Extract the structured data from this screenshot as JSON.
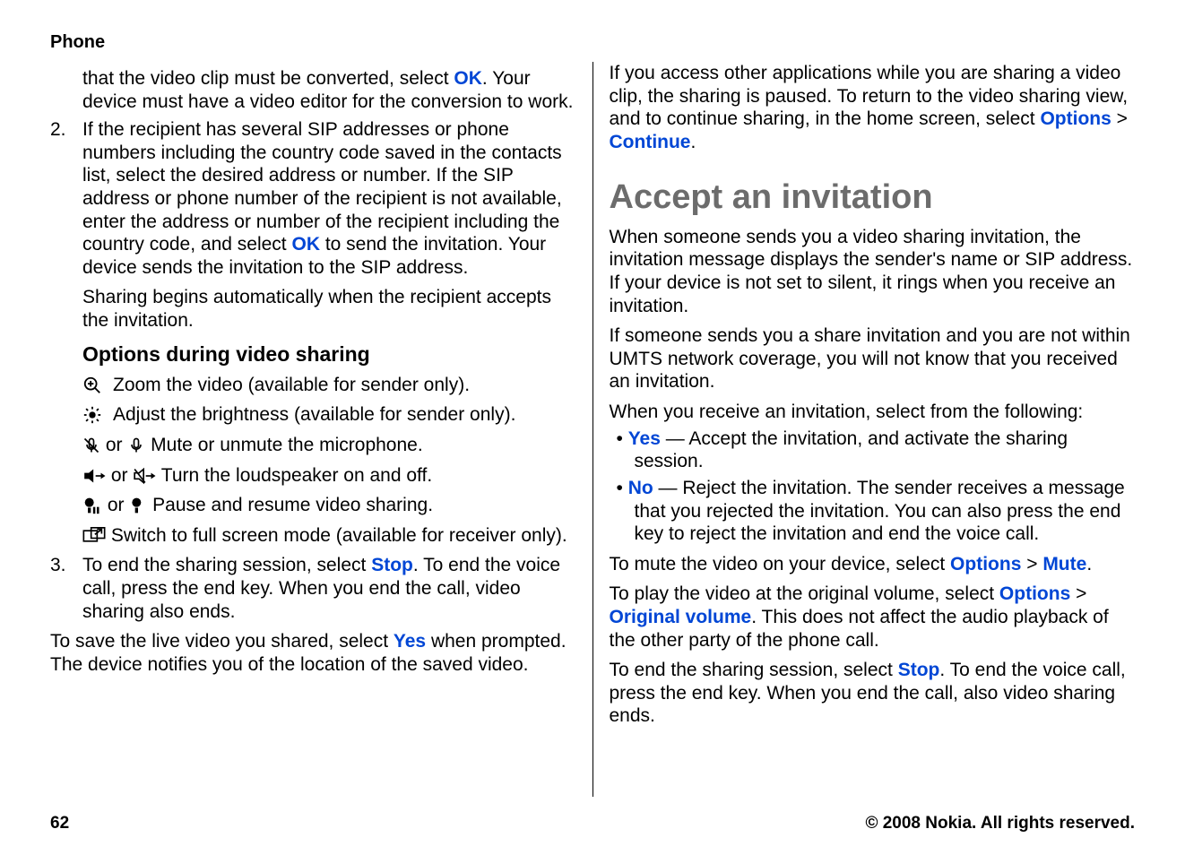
{
  "header": {
    "section": "Phone"
  },
  "left": {
    "step1_a": "that the video clip must be converted, select ",
    "step1_ok": "OK",
    "step1_b": ". Your device must have a video editor for the conversion to work.",
    "step2_num": "2.",
    "step2_a": "If the recipient has several SIP addresses or phone numbers including the country code saved in the contacts list, select the desired address or number. If the SIP address or phone number of the recipient is not available, enter the address or number of the recipient including the country code, and select ",
    "step2_ok": "OK",
    "step2_b": " to send the invitation. Your device sends the invitation to the SIP address.",
    "step2_c": "Sharing begins automatically when the recipient accepts the invitation.",
    "options_heading": "Options during video sharing",
    "zoom_text": "Zoom the video (available for sender only).",
    "brightness_text": "Adjust the brightness (available for sender only).",
    "or1": " or ",
    "mic_text": "  Mute or unmute the microphone.",
    "or2": " or ",
    "speaker_text": "  Turn the loudspeaker on and off.",
    "or3": " or ",
    "pause_text": "  Pause and resume video sharing.",
    "fullscreen_text": "   Switch to full screen mode (available for receiver only).",
    "step3_num": "3.",
    "step3_a": "To end the sharing session, select ",
    "step3_stop": "Stop",
    "step3_b": ". To end the voice call, press the end key. When you end the call, video sharing also ends.",
    "save_a": "To save the live video you shared, select ",
    "save_yes": "Yes",
    "save_b": " when prompted. The device notifies you of the location of the saved video."
  },
  "right": {
    "pause_a": "If you access other applications while you are sharing a video clip, the sharing is paused. To return to the video sharing view, and to continue sharing, in the home screen, select ",
    "pause_options": "Options",
    "gt": " > ",
    "pause_continue": "Continue",
    "pause_end": ".",
    "heading": "Accept an invitation",
    "p1": "When someone sends you a video sharing invitation, the invitation message displays the sender's name or SIP address. If your device is not set to silent, it rings when you receive an invitation.",
    "p2": "If someone sends you a share invitation and you are not within UMTS network coverage, you will not know that you received an invitation.",
    "p3": "When you receive an invitation, select from the following:",
    "yes_label": "Yes",
    "yes_text": "  — Accept the invitation, and activate the sharing session.",
    "no_label": "No",
    "no_text": "  — Reject the invitation. The sender receives a message that you rejected the invitation. You can also press the end key to reject the invitation and end the voice call.",
    "mute_a": "To mute the video on your device, select ",
    "mute_options": "Options",
    "mute_mute": "Mute",
    "mute_end": ".",
    "vol_a": "To play the video at the original volume, select ",
    "vol_options": "Options",
    "vol_orig": "Original volume",
    "vol_b": ". This does not affect the audio playback of the other party of the phone call.",
    "end_a": "To end the sharing session, select ",
    "end_stop": "Stop",
    "end_b": ". To end the voice call, press the end key. When you end the call, also video sharing ends."
  },
  "footer": {
    "page": "62",
    "copyright": "© 2008 Nokia. All rights reserved."
  }
}
